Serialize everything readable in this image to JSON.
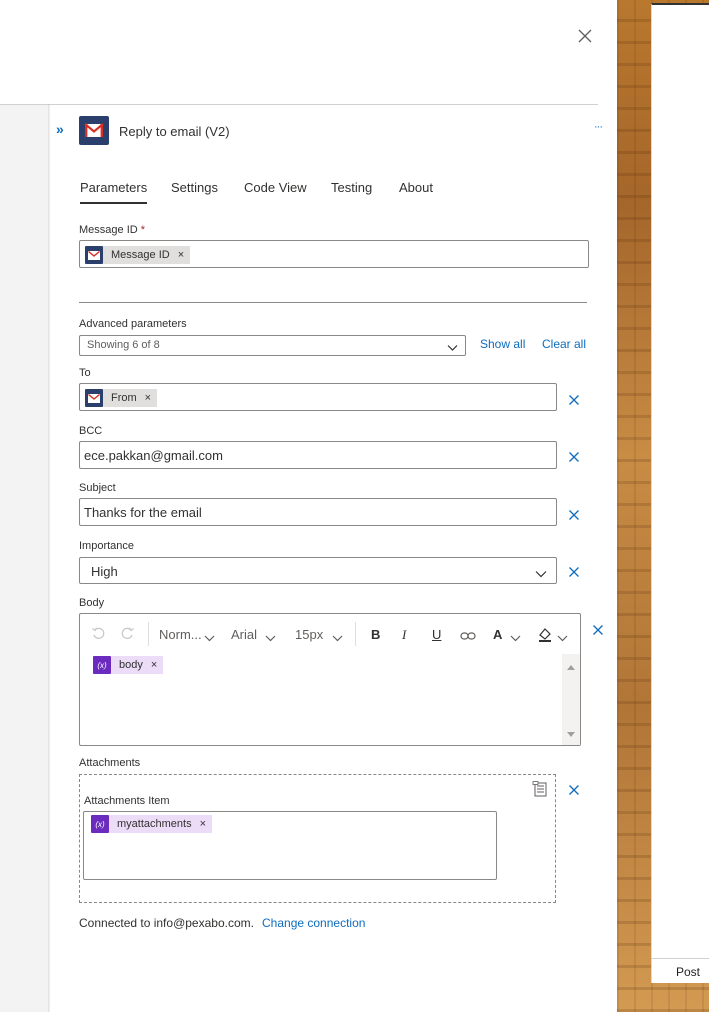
{
  "panel": {
    "title": "Reply to email (V2)",
    "more_label": "···",
    "collapse_label": "»"
  },
  "tabs": [
    {
      "label": "Parameters",
      "selected": true
    },
    {
      "label": "Settings"
    },
    {
      "label": "Code View"
    },
    {
      "label": "Testing"
    },
    {
      "label": "About"
    }
  ],
  "message_id": {
    "label": "Message ID",
    "required_mark": "*",
    "token": "Message ID"
  },
  "advanced": {
    "label": "Advanced parameters",
    "select_value": "Showing 6 of 8",
    "show_all": "Show all",
    "clear_all": "Clear all"
  },
  "to": {
    "label": "To",
    "token": "From"
  },
  "bcc": {
    "label": "BCC",
    "value": "ece.pakkan@gmail.com"
  },
  "subject": {
    "label": "Subject",
    "value": "Thanks for the email"
  },
  "importance": {
    "label": "Importance",
    "value": "High"
  },
  "body": {
    "label": "Body",
    "toolbar": {
      "paragraph": "Norm...",
      "font": "Arial",
      "size": "15px",
      "bold": "B",
      "italic": "I",
      "underline": "U",
      "font_color": "A"
    },
    "token": "body",
    "var_icon": "(x)"
  },
  "attachments": {
    "label": "Attachments",
    "item_label": "Attachments Item",
    "token": "myattachments"
  },
  "connection": {
    "text": "Connected to info@pexabo.com.",
    "change_link": "Change connection"
  },
  "side": {
    "post_label": "Post"
  },
  "colors": {
    "accent": "#0f6cbd",
    "gmail_badge": "#2b3f6c",
    "gmail_red": "#d93025",
    "variable_purple": "#6b2bbf"
  }
}
